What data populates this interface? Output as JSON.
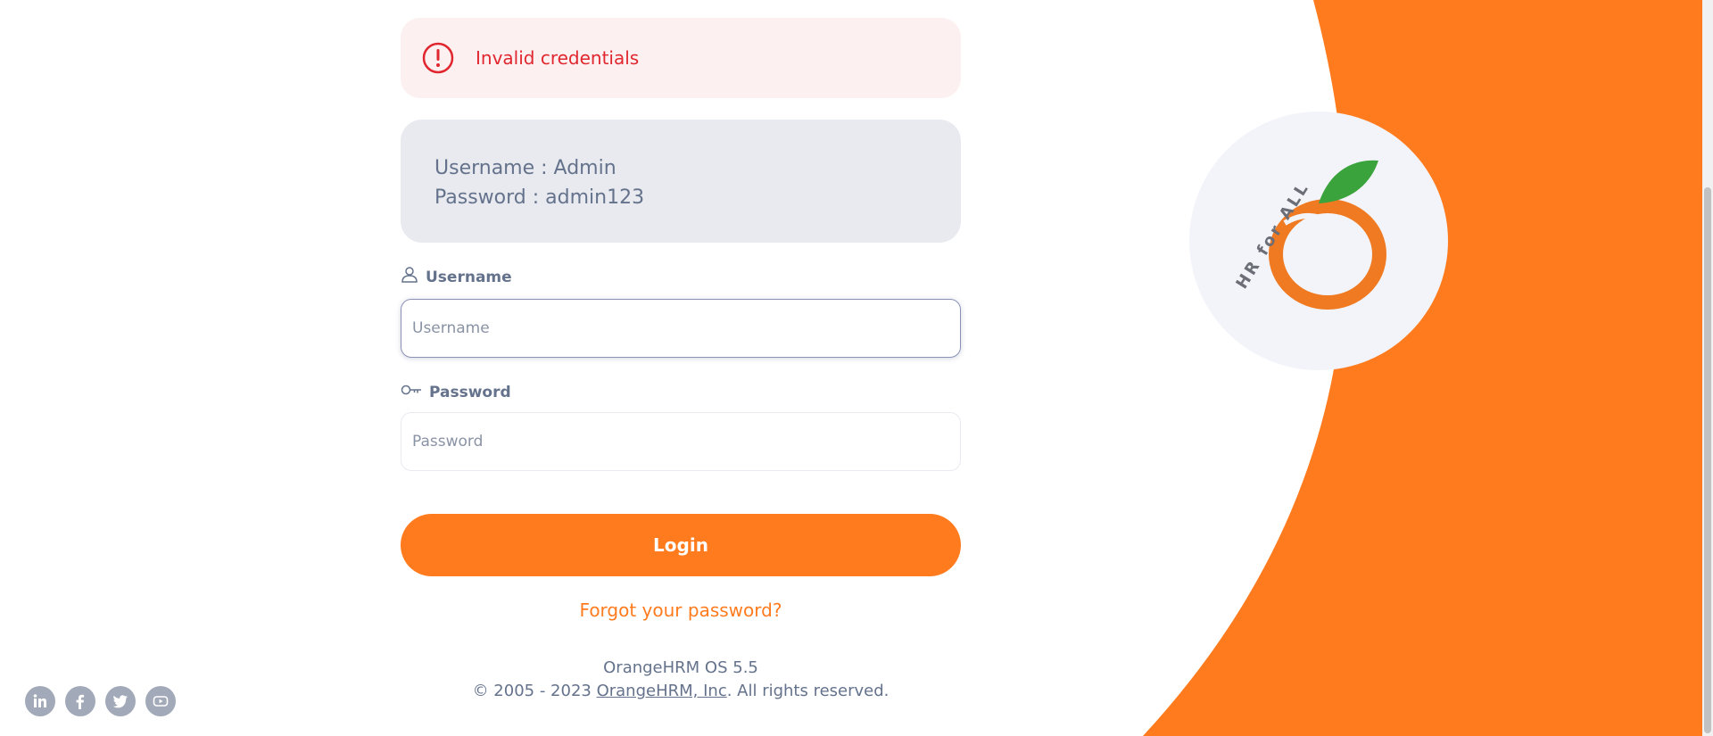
{
  "alert": {
    "icon": "exclamation-circle-icon",
    "message": "Invalid credentials"
  },
  "credentials_hint": {
    "username_line": "Username : Admin",
    "password_line": "Password : admin123"
  },
  "form": {
    "username": {
      "label": "Username",
      "icon": "user-icon",
      "placeholder": "Username",
      "value": ""
    },
    "password": {
      "label": "Password",
      "icon": "key-icon",
      "placeholder": "Password",
      "value": ""
    },
    "login_label": "Login",
    "forgot_label": "Forgot your password?"
  },
  "footer": {
    "version": "OrangeHRM OS 5.5",
    "copyright_prefix": "© 2005 - 2023 ",
    "company_link": "OrangeHRM, Inc",
    "copyright_suffix": ". All rights reserved."
  },
  "branding": {
    "logo_text": "HR for ALL"
  },
  "social": [
    "linkedin-icon",
    "facebook-icon",
    "twitter-icon",
    "youtube-icon"
  ],
  "colors": {
    "accent": "#ff7b1d",
    "error": "#e0262e",
    "muted_text": "#64728c",
    "hint_bg": "#e8eaef"
  }
}
